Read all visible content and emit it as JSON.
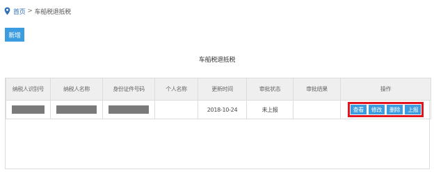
{
  "breadcrumb": {
    "home": "首页",
    "separator": ">",
    "current": "车船税退抵税"
  },
  "toolbar": {
    "add_label": "新增"
  },
  "page_title": "车船税退抵税",
  "table": {
    "headers": [
      "纳税人识别号",
      "纳税人名称",
      "身份证件号码",
      "个人名称",
      "更新时间",
      "审批状态",
      "审批结果",
      "操作"
    ],
    "rows": [
      {
        "taxpayer_id": "",
        "taxpayer_name": "",
        "id_number": "",
        "personal_name": "",
        "update_time": "2018-10-24",
        "approval_status": "未上报",
        "approval_result": ""
      }
    ],
    "actions": [
      "查看",
      "修改",
      "删除",
      "上报"
    ]
  },
  "colors": {
    "accent": "#3b9de0",
    "highlight": "#e4141e",
    "redaction": "#7a7a7a"
  }
}
